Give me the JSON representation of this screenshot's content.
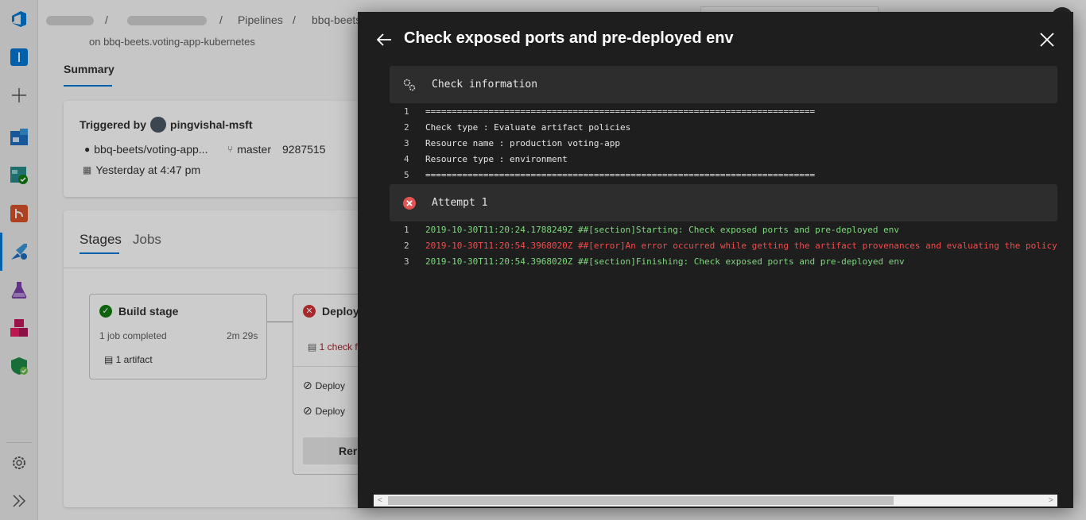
{
  "header": {
    "crumb_pipelines": "Pipelines",
    "crumb_sep": "/",
    "crumb_pipeline": "bbq-beets"
  },
  "run": {
    "subtitle": "on bbq-beets.voting-app-kubernetes",
    "tab_summary": "Summary",
    "triggered_label": "Triggered by",
    "triggered_user": "pingvishal-msft",
    "repo": "bbq-beets/voting-app...",
    "branch": "master",
    "commit": "9287515",
    "time": "Yesterday at 4:47 pm"
  },
  "stages": {
    "tab_stages": "Stages",
    "tab_jobs": "Jobs",
    "build": {
      "name": "Build stage",
      "jobs": "1 job completed",
      "duration": "2m 29s",
      "artifact": "1 artifact"
    },
    "deploy": {
      "name": "Deploy",
      "checks": "1 check f",
      "job1": "Deploy",
      "job2": "Deploy",
      "rerun": "Reru"
    }
  },
  "panel": {
    "title": "Check exposed ports and pre-deployed env",
    "section1": {
      "label": "Check information",
      "lines": [
        {
          "n": "1",
          "t": "=========================================================================="
        },
        {
          "n": "2",
          "t": "Check type : Evaluate artifact policies"
        },
        {
          "n": "3",
          "t": "Resource name : production voting-app"
        },
        {
          "n": "4",
          "t": "Resource type : environment"
        },
        {
          "n": "5",
          "t": "=========================================================================="
        }
      ]
    },
    "section2": {
      "label": "Attempt 1",
      "lines": [
        {
          "n": "1",
          "t": "2019-10-30T11:20:24.1788249Z ##[section]Starting: Check exposed ports and pre-deployed env",
          "status": "ok"
        },
        {
          "n": "2",
          "t": "2019-10-30T11:20:54.3968020Z ##[error]An error occurred while getting the artifact provenances and evaluating the policy.",
          "status": "err"
        },
        {
          "n": "3",
          "t": "2019-10-30T11:20:54.3968020Z ##[section]Finishing: Check exposed ports and pre-deployed env",
          "status": "ok"
        }
      ]
    }
  },
  "colors": {
    "accent": "#0078d4",
    "success": "#107c10",
    "error": "#d13438",
    "log_ok": "#7ed97e",
    "log_err": "#f14c4c"
  },
  "icons": [
    "azure-devops-logo-icon",
    "overview-icon",
    "plus-icon",
    "boards-icon",
    "test-plans-icon",
    "repos-icon",
    "pipelines-icon",
    "test-icon",
    "artifacts-icon",
    "security-icon",
    "settings-gear-icon",
    "expand-chevrons-icon",
    "back-arrow-icon",
    "close-icon",
    "gears-icon",
    "error-circle-icon"
  ]
}
